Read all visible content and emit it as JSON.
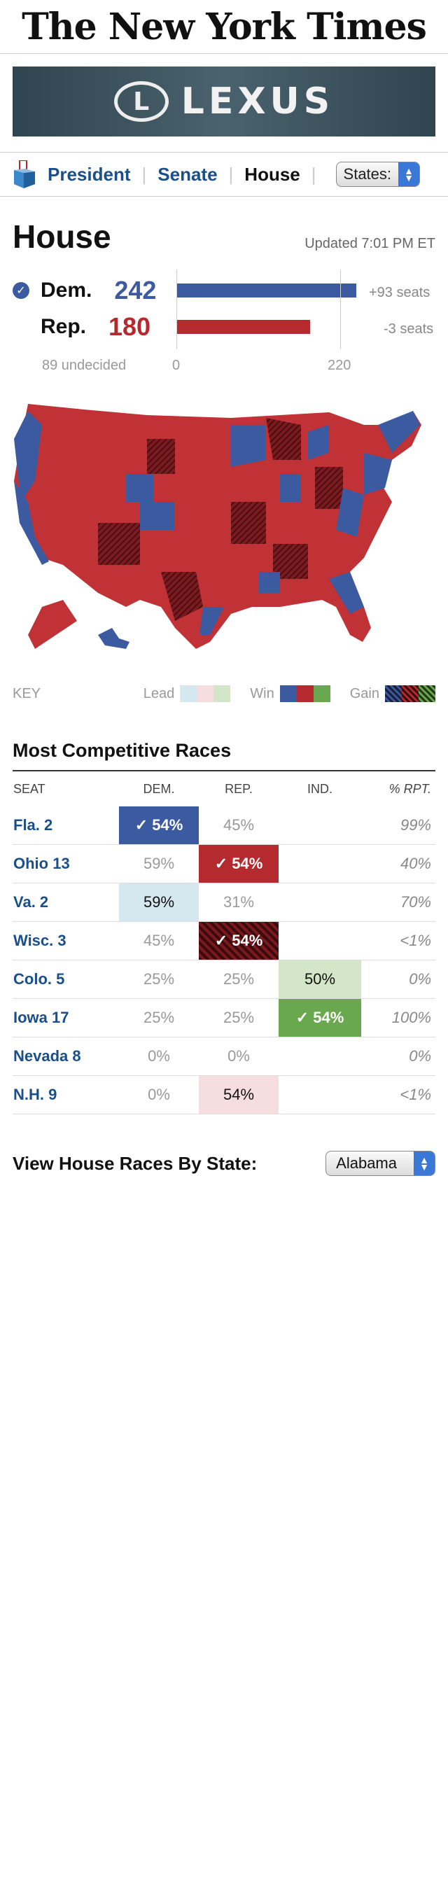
{
  "masthead": {
    "title": "The New York Times"
  },
  "ad": {
    "brand": "LEXUS",
    "logo_letter": "L"
  },
  "nav": {
    "items": [
      "President",
      "Senate",
      "House"
    ],
    "active": "House",
    "states_select": "States:"
  },
  "house": {
    "title": "House",
    "updated": "Updated 7:01 PM ET",
    "dem": {
      "label": "Dem.",
      "seats": "242",
      "change": "+93 seats",
      "winner": true
    },
    "rep": {
      "label": "Rep.",
      "seats": "180",
      "change": "-3 seats"
    },
    "undecided": "89 undecided",
    "axis_start": "0",
    "axis_majority": "220"
  },
  "bar_values": {
    "dem": 242,
    "rep": 180,
    "max": 265
  },
  "key": {
    "label": "KEY",
    "lead": "Lead",
    "win": "Win",
    "gain": "Gain"
  },
  "colors": {
    "dem_win": "#3b5aa0",
    "rep_win": "#b52a2f",
    "ind_win": "#6aa84f",
    "dem_lead": "#d5e8f0",
    "rep_lead": "#f6dde0",
    "ind_lead": "#d3e6c8",
    "rep_gain": "#7a1a1e"
  },
  "races": {
    "title": "Most Competitive Races",
    "headers": {
      "seat": "SEAT",
      "dem": "DEM.",
      "rep": "REP.",
      "ind": "IND.",
      "rpt": "% RPT."
    },
    "rows": [
      {
        "seat": "Fla. 2",
        "dem": "54%",
        "rep": "45%",
        "ind": "",
        "rpt": "99%"
      },
      {
        "seat": "Ohio 13",
        "dem": "59%",
        "rep": "54%",
        "ind": "",
        "rpt": "40%"
      },
      {
        "seat": "Va. 2",
        "dem": "59%",
        "rep": "31%",
        "ind": "",
        "rpt": "70%"
      },
      {
        "seat": "Wisc. 3",
        "dem": "45%",
        "rep": "54%",
        "ind": "",
        "rpt": "<1%"
      },
      {
        "seat": "Colo. 5",
        "dem": "25%",
        "rep": "25%",
        "ind": "50%",
        "rpt": "0%"
      },
      {
        "seat": "Iowa 17",
        "dem": "25%",
        "rep": "25%",
        "ind": "54%",
        "rpt": "100%"
      },
      {
        "seat": "Nevada 8",
        "dem": "0%",
        "rep": "0%",
        "ind": "",
        "rpt": "0%"
      },
      {
        "seat": "N.H. 9",
        "dem": "0%",
        "rep": "54%",
        "ind": "",
        "rpt": "<1%"
      }
    ]
  },
  "by_state": {
    "label": "View House Races By State:",
    "selected": "Alabama"
  }
}
